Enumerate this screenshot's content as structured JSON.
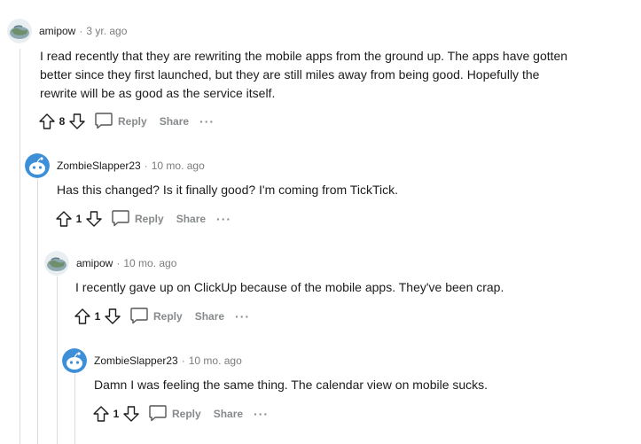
{
  "comments": [
    {
      "author": "amipow",
      "separator": "·",
      "time": "3 yr. ago",
      "lines": [
        "I read recently that they are rewriting the mobile apps from the ground up. The apps have gotten",
        "better since they first launched, but they are still miles away from being good. Hopefully the",
        "rewrite will be as good as the service itself."
      ],
      "votes": "8",
      "reply_label": "Reply",
      "share_label": "Share",
      "more_label": "···",
      "avatar": "globe-avatar-icon"
    },
    {
      "author": "ZombieSlapper23",
      "separator": "·",
      "time": "10 mo. ago",
      "lines": [
        "Has this changed? Is it finally good? I'm coming from TickTick."
      ],
      "votes": "1",
      "reply_label": "Reply",
      "share_label": "Share",
      "more_label": "···",
      "avatar": "snoo-avatar-icon"
    },
    {
      "author": "amipow",
      "separator": "·",
      "time": "10 mo. ago",
      "lines": [
        "I recently gave up on ClickUp because of the mobile apps. They've been crap."
      ],
      "votes": "1",
      "reply_label": "Reply",
      "share_label": "Share",
      "more_label": "···",
      "avatar": "globe-avatar-icon"
    },
    {
      "author": "ZombieSlapper23",
      "separator": "·",
      "time": "10 mo. ago",
      "lines": [
        "Damn I was feeling the same thing. The calendar view on mobile sucks."
      ],
      "votes": "1",
      "reply_label": "Reply",
      "share_label": "Share",
      "more_label": "···",
      "avatar": "snoo-avatar-icon"
    }
  ],
  "colors": {
    "text": "#1c1c1c",
    "muted": "#7c7c7c",
    "action": "#878a8c",
    "thread_line": "#dadce0",
    "snoo_blue": "#3d8fd8"
  }
}
